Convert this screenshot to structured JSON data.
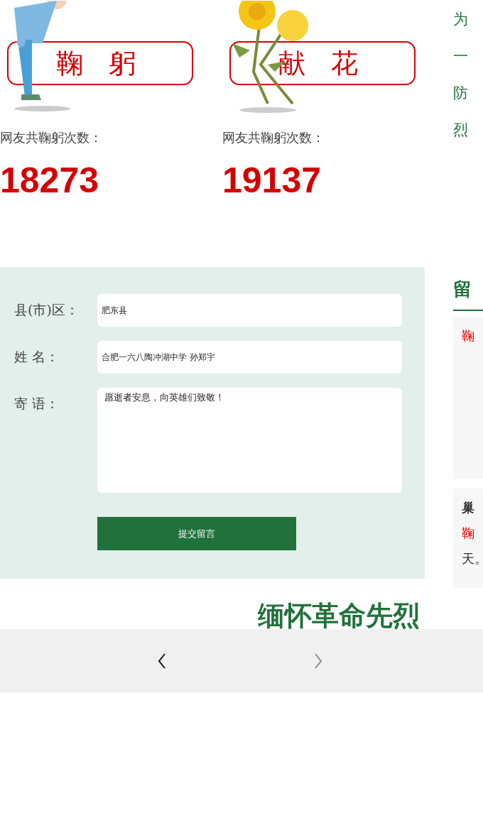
{
  "cards": [
    {
      "kind": "bow",
      "label": "鞠 躬",
      "count_label": "网友共鞠躬次数：",
      "count": "18273"
    },
    {
      "kind": "flower",
      "label": "献 花",
      "count_label": "网友共鞠躬次数：",
      "count": "19137"
    }
  ],
  "intro_lines": [
    "为",
    "一",
    "防",
    "烈"
  ],
  "form": {
    "fields": [
      {
        "kind": "input",
        "label": "县(市)区：",
        "value": "肥东县"
      },
      {
        "kind": "input",
        "label": "姓 名：",
        "value": "合肥一六八陶冲湖中学 孙郑宇"
      },
      {
        "kind": "textarea",
        "label": "寄 语：",
        "value": "愿逝者安息，向英雄们致敬！"
      }
    ],
    "submit": "提交留言"
  },
  "messages": {
    "title": "留",
    "items": [
      {
        "lines": [
          {
            "kind": "action",
            "text": "鞠"
          }
        ]
      },
      {
        "lines": [
          {
            "kind": "author",
            "text": "巢"
          },
          {
            "kind": "action",
            "text": "鞠"
          },
          {
            "kind": "body",
            "text": "天。"
          }
        ]
      }
    ]
  },
  "banner_title": "缅怀革命先烈",
  "nav": {
    "prev": {
      "disabled": false
    },
    "next": {
      "disabled": true
    }
  }
}
